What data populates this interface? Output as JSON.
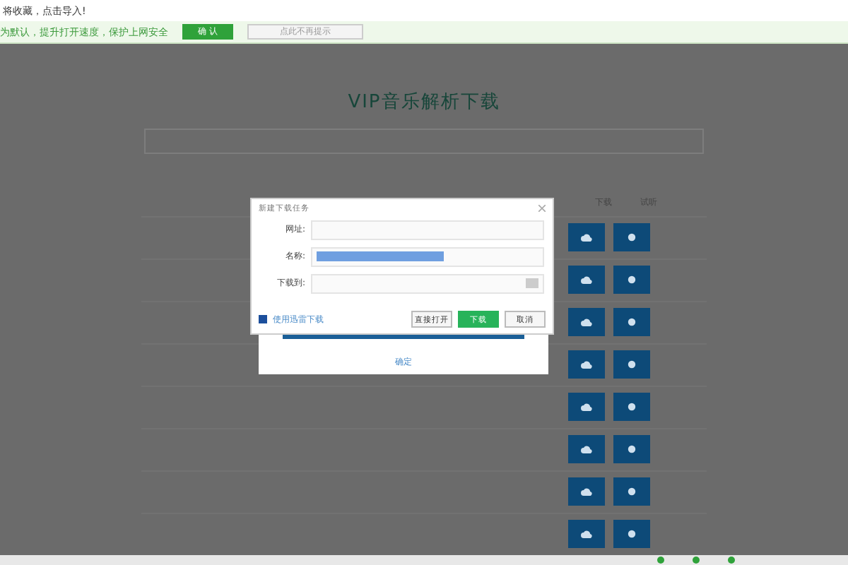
{
  "notice": {
    "text": "将收藏，点击导入!"
  },
  "security_bar": {
    "text": "为默认，提升打开速度，保护上网安全",
    "confirm": "确 认",
    "dismiss": "点此不再提示"
  },
  "page": {
    "title": "VIP音乐解析下载",
    "table": {
      "columns": [
        "下载",
        "试听"
      ],
      "rows": [
        {
          "actions": [
            {
              "kind": "download"
            },
            {
              "kind": "play"
            }
          ]
        },
        {
          "actions": [
            {
              "kind": "download"
            },
            {
              "kind": "play"
            }
          ]
        },
        {
          "actions": [
            {
              "kind": "download"
            },
            {
              "kind": "play"
            }
          ]
        },
        {
          "actions": [
            {
              "kind": "download"
            },
            {
              "kind": "play"
            }
          ]
        },
        {
          "actions": [
            {
              "kind": "download"
            },
            {
              "kind": "play"
            }
          ]
        },
        {
          "actions": [
            {
              "kind": "download"
            },
            {
              "kind": "play"
            }
          ]
        },
        {
          "actions": [
            {
              "kind": "download"
            },
            {
              "kind": "play"
            }
          ]
        },
        {
          "actions": [
            {
              "kind": "download"
            },
            {
              "kind": "play"
            }
          ]
        }
      ]
    }
  },
  "behind_panel": {
    "link": "确定"
  },
  "dialog": {
    "title": "新建下载任务",
    "fields": [
      {
        "label": "网址:",
        "kind": "plain"
      },
      {
        "label": "名称:",
        "kind": "selected"
      },
      {
        "label": "下载到:",
        "kind": "folder"
      }
    ],
    "thunder_link": "使用迅雷下载",
    "buttons": [
      {
        "label": "直接打开",
        "primary": false
      },
      {
        "label": "下载",
        "primary": true
      },
      {
        "label": "取消",
        "primary": false
      }
    ]
  }
}
